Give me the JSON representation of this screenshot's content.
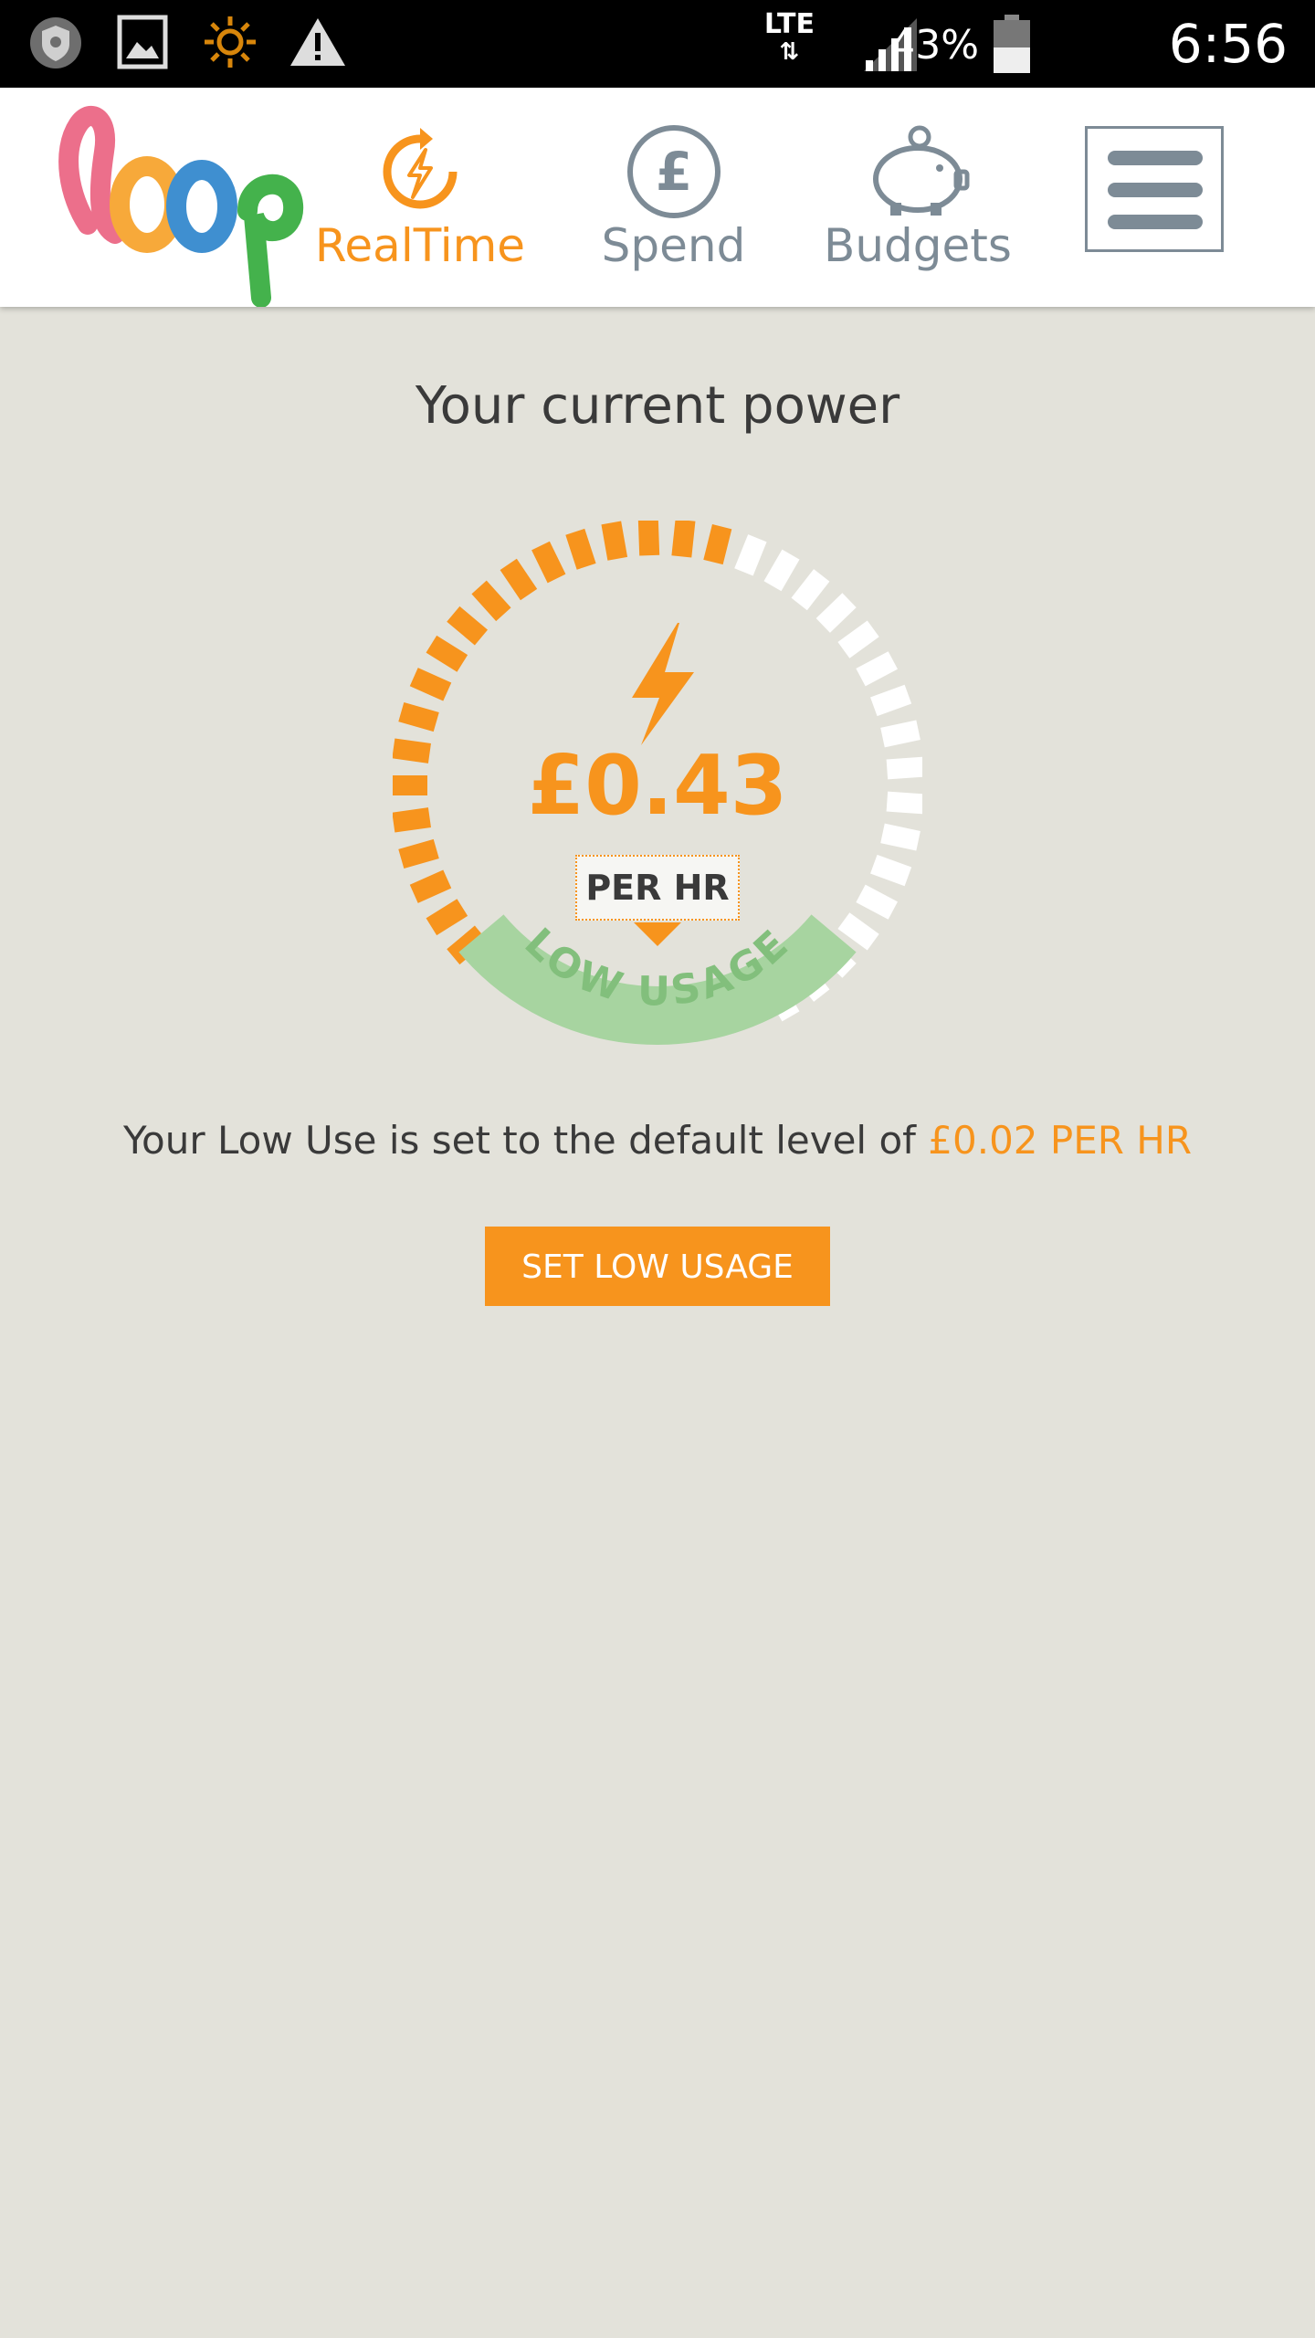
{
  "status_bar": {
    "network": "LTE",
    "battery_percent": "43%",
    "time": "6:56 p.m.",
    "icons": [
      "shield-icon",
      "gallery-icon",
      "sun-icon",
      "warning-icon",
      "data-arrows-icon",
      "signal-icon",
      "battery-icon"
    ]
  },
  "header": {
    "logo": "loop-logo",
    "nav": [
      {
        "label": "RealTime",
        "icon": "bolt-circle-icon",
        "active": true
      },
      {
        "label": "Spend",
        "icon": "pound-circle-icon",
        "active": false
      },
      {
        "label": "Budgets",
        "icon": "piggy-bank-icon",
        "active": false
      }
    ],
    "menu_icon": "hamburger-icon"
  },
  "main": {
    "title": "Your current power",
    "gauge": {
      "filled_fraction": 0.52,
      "zone_label": "LOW USAGE",
      "icon": "bolt-icon"
    },
    "price": "£0.43",
    "unit": "PER HR",
    "low_use_text": "Your Low Use is set to the default level of",
    "low_use_value": "£0.02 PER HR",
    "set_button": "SET LOW USAGE"
  },
  "colors": {
    "accent": "#f7941d",
    "nav_inactive": "#7d8b96",
    "low_zone": "#a7d4a0",
    "background": "#e3e2da"
  }
}
